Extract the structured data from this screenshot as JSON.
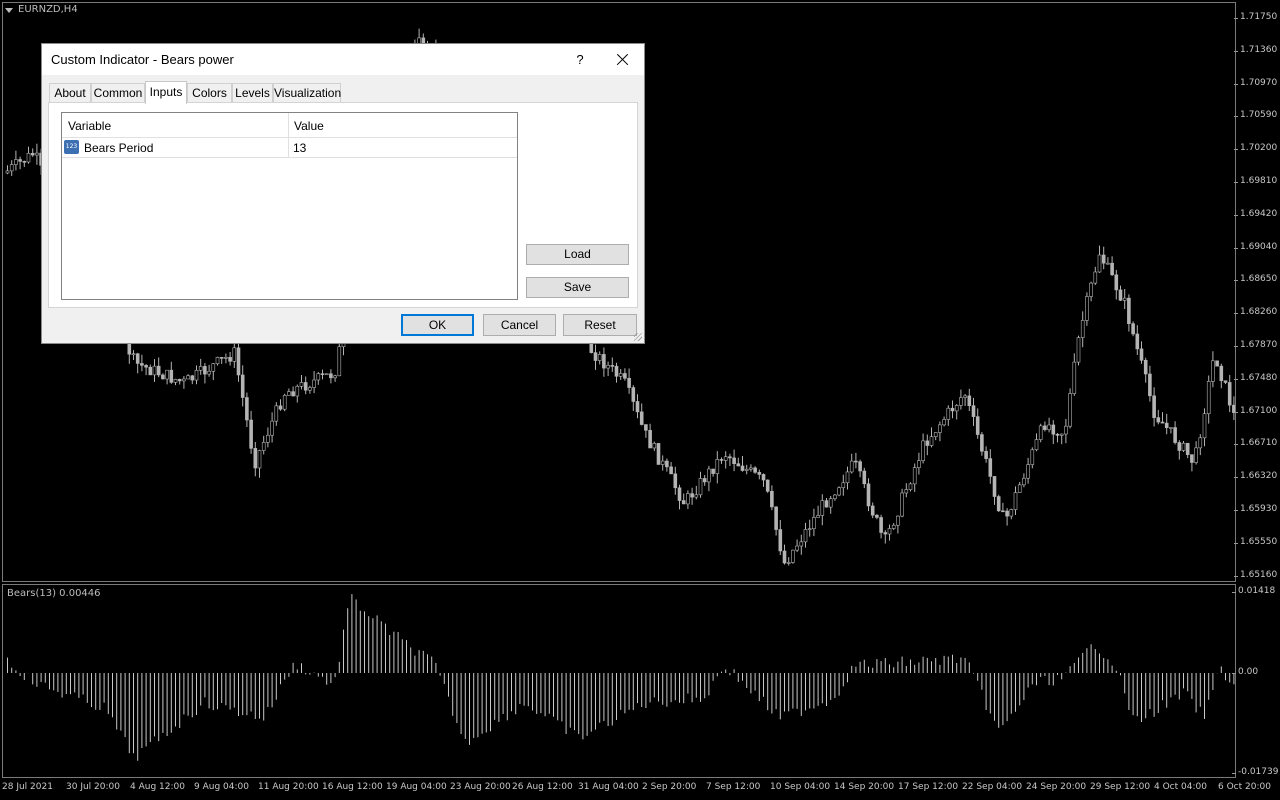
{
  "chart": {
    "symbol": "EURNZD,H4",
    "indicator_label": "Bears(13) 0.00446",
    "price_ticks": [
      "1.71750",
      "1.71360",
      "1.70970",
      "1.70590",
      "1.70200",
      "1.69810",
      "1.69420",
      "1.69040",
      "1.68650",
      "1.68260",
      "1.67870",
      "1.67480",
      "1.67100",
      "1.66710",
      "1.66320",
      "1.65930",
      "1.65550",
      "1.65160"
    ],
    "indicator_ticks": [
      "0.01418",
      "0.00",
      "-0.01739"
    ],
    "time_ticks": [
      "28 Jul 2021",
      "30 Jul 20:00",
      "4 Aug 12:00",
      "9 Aug 04:00",
      "11 Aug 20:00",
      "16 Aug 12:00",
      "19 Aug 04:00",
      "23 Aug 20:00",
      "26 Aug 12:00",
      "31 Aug 04:00",
      "2 Sep 20:00",
      "7 Sep 12:00",
      "10 Sep 04:00",
      "14 Sep 20:00",
      "17 Sep 12:00",
      "22 Sep 04:00",
      "24 Sep 20:00",
      "29 Sep 12:00",
      "4 Oct 04:00",
      "6 Oct 20:00"
    ],
    "candle_color": "#b4b4b4",
    "histogram_color": "#c8c8c8",
    "background": "#000000"
  },
  "dialog": {
    "title": "Custom Indicator - Bears power",
    "help_label": "?",
    "tabs": [
      {
        "label": "About"
      },
      {
        "label": "Common"
      },
      {
        "label": "Inputs"
      },
      {
        "label": "Colors"
      },
      {
        "label": "Levels"
      },
      {
        "label": "Visualization"
      }
    ],
    "active_tab": "Inputs",
    "inputs": {
      "columns": {
        "variable": "Variable",
        "value": "Value"
      },
      "rows": [
        {
          "icon": "integer-param-icon",
          "icon_text": "123",
          "name": "Bears Period",
          "value": "13"
        }
      ]
    },
    "buttons": {
      "load": "Load",
      "save": "Save",
      "ok": "OK",
      "cancel": "Cancel",
      "reset": "Reset"
    },
    "accent": "#0078d7"
  }
}
